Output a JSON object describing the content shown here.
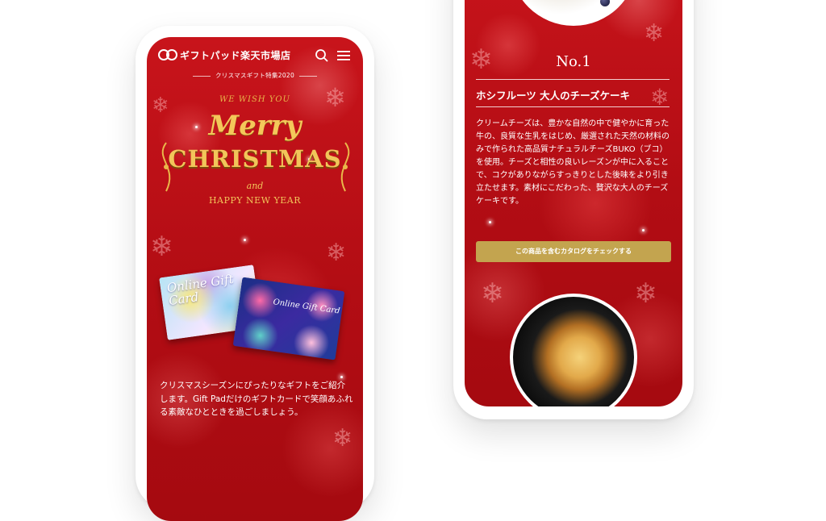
{
  "left_phone": {
    "header": {
      "shop_name": "ギフトパッド楽天市場店",
      "logo_icon": "giftpad-logo-icon",
      "search_icon": "search-icon",
      "menu_icon": "hamburger-menu-icon"
    },
    "subtitle": "クリスマスギフト特集2020",
    "hero": {
      "wish": "WE WISH YOU",
      "merry": "Merry",
      "christmas": "CHRISTMAS",
      "and": "and",
      "new_year": "HAPPY NEW YEAR"
    },
    "cards": {
      "card1_text": "Online Gift Card",
      "card2_text": "Online Gift Card"
    },
    "intro": "クリスマスシーズンにぴったりなギフトをご紹介します。Gift Padだけのギフトカードで笑顔あふれる素敵なひとときを過ごしましょう。"
  },
  "right_phone": {
    "rank": "No.1",
    "product_name": "ホシフルーツ 大人のチーズケーキ",
    "description": "クリームチーズは、豊かな自然の中で健やかに育った牛の、良質な生乳をはじめ、厳選された天然の材料のみで作られた高品質ナチュラルチーズBUKO（ブコ）を使用。チーズと相性の良いレーズンが中に入ることで、コクがありながらすっきりとした後味をより引き立たせます。素材にこだわった、贅沢な大人のチーズケーキです。",
    "cta_label": "この商品を含むカタログをチェックする"
  },
  "colors": {
    "background_red": "#b30d14",
    "gold": "#c3a44f",
    "title_gold": "#f2c55a"
  }
}
